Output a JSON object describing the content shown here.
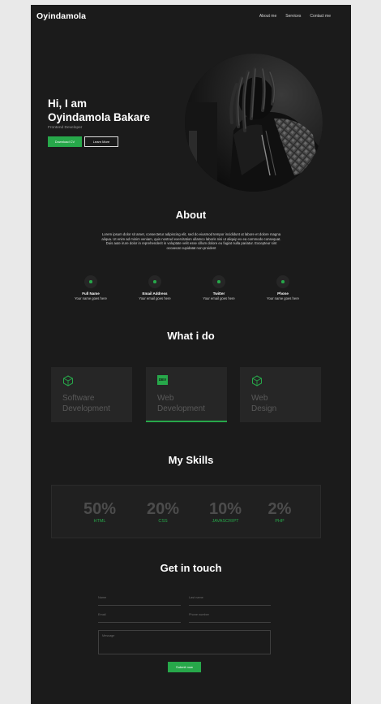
{
  "nav": {
    "logo": "Oyindamola",
    "links": [
      "About me",
      "Services",
      "Contact me"
    ]
  },
  "hero": {
    "greeting": "Hi, I am",
    "name": "Oyindamola Bakare",
    "role": "Frontend Developer",
    "primary_button": "Download CV",
    "secondary_button": "Learn More"
  },
  "about": {
    "title": "About",
    "body": "Lorem ipsum dolor sit amet, consectetur adipiscing elit, sed do eiusmod tempor incididunt ut labore et dolore magna aliqua. Ut enim ad minim veniam, quis nostrud exercitation ullamco laboris nisi ut aliquip ex ea commodo consequat. Duis aute irure dolor in reprehenderit in voluptate velit esse cillum dolore eu fugiat nulla pariatur. Excepteur sint occaecat cupidatat non proident",
    "info": [
      {
        "label": "Full Name",
        "value": "Your name goes here"
      },
      {
        "label": "Email Address",
        "value": "Your email goes here"
      },
      {
        "label": "Twitter",
        "value": "Your email goes here"
      },
      {
        "label": "Phone",
        "value": "Your name goes here"
      }
    ]
  },
  "services": {
    "title": "What i do",
    "cards": [
      {
        "line1": "Software",
        "line2": "Development",
        "icon": "cube-icon"
      },
      {
        "line1": "Web",
        "line2": "Development",
        "icon": "dev-badge-icon",
        "badge": "DEV"
      },
      {
        "line1": "Web",
        "line2": "Design",
        "icon": "cube-icon"
      }
    ]
  },
  "skills": {
    "title": "My Skills",
    "items": [
      {
        "percent": "50%",
        "name": "HTML"
      },
      {
        "percent": "20%",
        "name": "CSS"
      },
      {
        "percent": "10%",
        "name": "JAVASCRIPT"
      },
      {
        "percent": "2%",
        "name": "PHP"
      }
    ]
  },
  "contact": {
    "title": "Get in touch",
    "name_placeholder": "Name",
    "lastname_placeholder": "Last name",
    "email_placeholder": "Email",
    "phone_placeholder": "Phone number",
    "message_placeholder": "Message",
    "submit": "Submit now"
  },
  "colors": {
    "accent": "#27a84a",
    "background": "#1b1b1b",
    "card": "#262626"
  }
}
